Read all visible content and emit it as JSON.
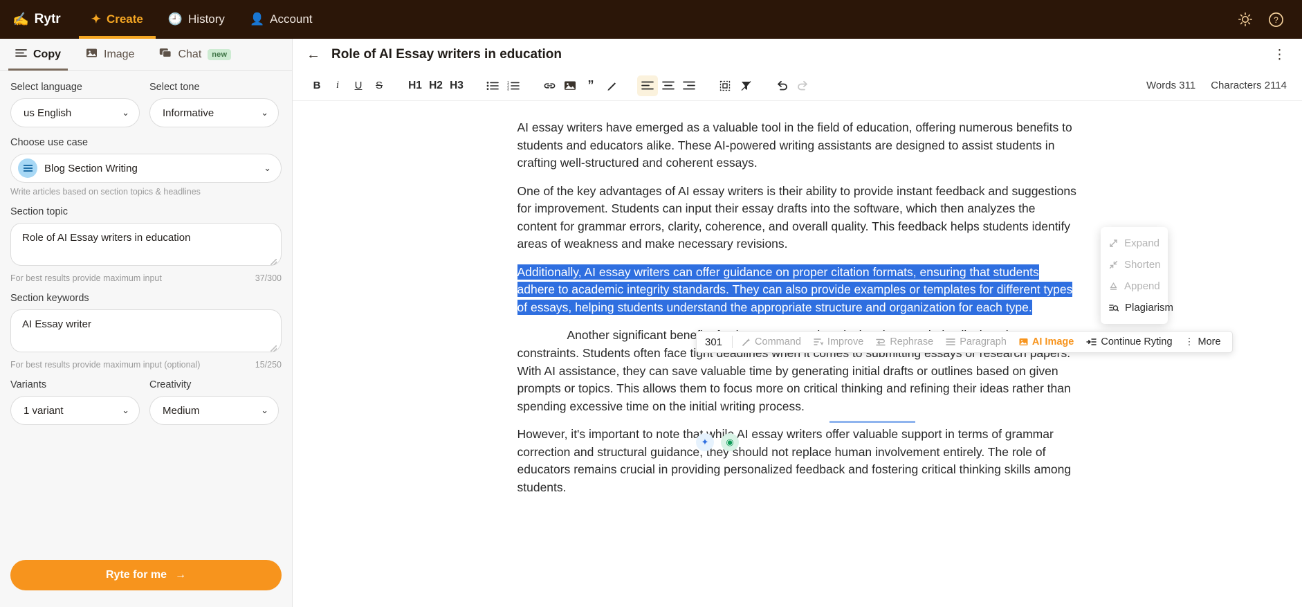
{
  "topnav": {
    "brand": "Rytr",
    "items": [
      {
        "label": "Create",
        "icon": "sparkle-icon",
        "active": true
      },
      {
        "label": "History",
        "icon": "clock-history-icon",
        "active": false
      },
      {
        "label": "Account",
        "icon": "person-icon",
        "active": false
      }
    ],
    "right_icons": [
      {
        "name": "theme-toggle-icon",
        "glyph": "☀"
      },
      {
        "name": "help-icon",
        "glyph": "?"
      }
    ]
  },
  "left_panel": {
    "tabs": [
      {
        "label": "Copy",
        "icon": "lines-icon",
        "active": true,
        "badge": ""
      },
      {
        "label": "Image",
        "icon": "image-icon",
        "active": false,
        "badge": ""
      },
      {
        "label": "Chat",
        "icon": "chat-icon",
        "active": false,
        "badge": "new"
      }
    ],
    "language": {
      "label": "Select language",
      "value": "us English"
    },
    "tone": {
      "label": "Select tone",
      "value": "Informative"
    },
    "use_case": {
      "label": "Choose use case",
      "value": "Blog Section Writing",
      "helper": "Write articles based on section topics & headlines"
    },
    "section_topic": {
      "label": "Section topic",
      "value": "Role of AI Essay writers in education",
      "placeholder": "Section topic",
      "helper": "For best results provide maximum input",
      "counter": "37/300"
    },
    "section_keywords": {
      "label": "Section keywords",
      "value": "AI Essay writer",
      "placeholder": "Section keywords",
      "helper": "For best results provide maximum input (optional)",
      "counter": "15/250"
    },
    "variants": {
      "label": "Variants",
      "value": "1 variant"
    },
    "creativity": {
      "label": "Creativity",
      "value": "Medium"
    },
    "submit": {
      "label": "Ryte for me",
      "arrow": "→",
      "color": "#f7941d"
    }
  },
  "document": {
    "title": "Role of AI Essay writers in education",
    "back_icon": "back-arrow-icon",
    "menu_icon": "kebab-menu-icon"
  },
  "toolbar": {
    "bold": "B",
    "italic": "i",
    "underline": "U",
    "strike": "S",
    "h1": "H1",
    "h2": "H2",
    "h3": "H3",
    "bullet_list": "bulleted-list-icon",
    "numbered_list": "numbered-list-icon",
    "link": "link-icon",
    "image": "image-icon",
    "quote": "quote-icon",
    "highlight": "pen-icon",
    "align_left": "align-left-icon",
    "align_center": "align-center-icon",
    "align_right": "align-right-icon",
    "frame": "frame-icon",
    "clear_format": "clear-format-icon",
    "undo": "undo-icon",
    "redo": "redo-icon",
    "words_label": "Words",
    "words_value": "311",
    "characters_label": "Characters",
    "characters_value": "2114"
  },
  "float_toolbar": {
    "count": "301",
    "items": [
      {
        "label": "Command",
        "icon": "magic-wand-icon",
        "state": "disabled"
      },
      {
        "label": "Improve",
        "icon": "improve-icon",
        "state": "disabled"
      },
      {
        "label": "Rephrase",
        "icon": "rephrase-icon",
        "state": "disabled"
      },
      {
        "label": "Paragraph",
        "icon": "paragraph-icon",
        "state": "disabled"
      },
      {
        "label": "AI Image",
        "icon": "ai-image-icon",
        "state": "accent"
      },
      {
        "label": "Continue Ryting",
        "icon": "continue-icon",
        "state": "enabled"
      },
      {
        "label": "More",
        "icon": "kebab-menu-icon",
        "state": "enabled"
      }
    ]
  },
  "dropdown": {
    "items": [
      {
        "label": "Expand",
        "icon": "expand-arrows-icon",
        "state": "disabled"
      },
      {
        "label": "Shorten",
        "icon": "shrink-arrows-icon",
        "state": "disabled"
      },
      {
        "label": "Append",
        "icon": "append-icon",
        "state": "disabled"
      },
      {
        "label": "Plagiarism",
        "icon": "plagiarism-search-icon",
        "state": "enabled"
      }
    ]
  },
  "editor": {
    "paragraphs": [
      {
        "id": "p1",
        "text": "AI essay writers have emerged as a valuable tool in the field of education, offering numerous benefits to students and educators alike. These AI-powered writing assistants are designed to assist students in crafting well-structured and coherent essays.",
        "selected": false
      },
      {
        "id": "p2",
        "text": "One of the key advantages of AI essay writers is their ability to provide instant feedback and suggestions for improvement. Students can input their essay drafts into the software, which then analyzes the content for grammar errors, clarity, coherence, and overall quality. This feedback helps students identify areas of weakness and make necessary revisions.",
        "selected": false
      },
      {
        "id": "p3",
        "text": "Additionally, AI essay writers can offer guidance on proper citation formats, ensuring that students adhere to academic integrity standards. They can also provide examples or templates for different types of essays, helping students understand the appropriate structure and organization for each type.",
        "selected": true
      },
      {
        "id": "p4",
        "text": "Another significant benefit of using AI essay writers is that they can help alleviate time constraints. Students often face tight deadlines when it comes to submitting essays or research papers. With AI assistance, they can save valuable time by generating initial drafts or outlines based on given prompts or topics. This allows them to focus more on critical thinking and refining their ideas rather than spending excessive time on the initial writing process.",
        "selected": false
      },
      {
        "id": "p5",
        "text": "However, it's important to note that while AI essay writers offer valuable support in terms of grammar correction and structural guidance, they should not replace human involvement entirely. The role of educators remains crucial in providing personalized feedback and fostering critical thinking skills among students.",
        "selected": false
      }
    ],
    "inline_chips": [
      {
        "name": "ai-sparkle-chip",
        "glyph": "✦"
      },
      {
        "name": "grammar-check-chip",
        "glyph": "◉"
      }
    ],
    "selection_color": "#2f6fe0"
  }
}
